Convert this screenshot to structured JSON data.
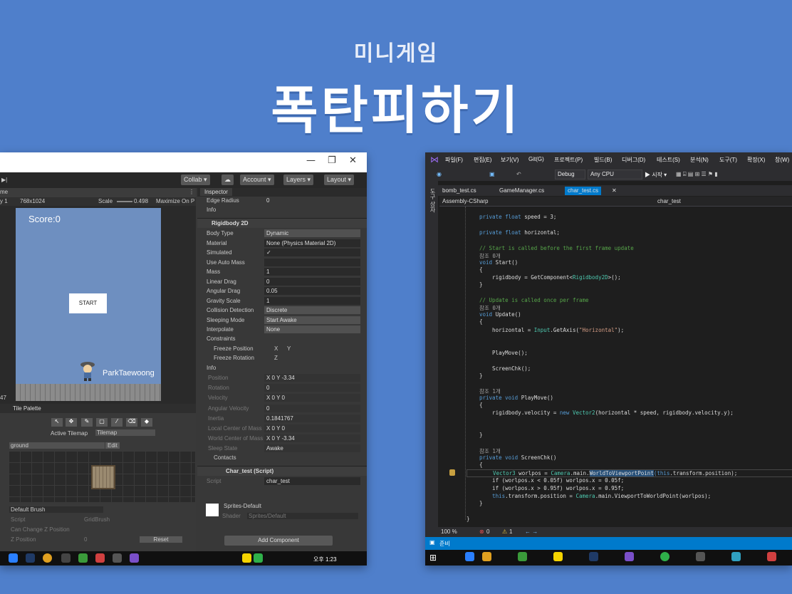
{
  "header": {
    "subtitle": "미니게임",
    "title": "폭탄피하기"
  },
  "unity": {
    "toolbar": {
      "collab": "Collab ▾",
      "account": "Account ▾",
      "layers": "Layers ▾",
      "layout": "Layout ▾"
    },
    "game": {
      "tab": "me",
      "display": "y 1",
      "resolution": "768x1024",
      "scale_label": "Scale",
      "scale_value": "0.498",
      "maximize": "Maximize On P",
      "score": "Score:0",
      "start": "START",
      "player_name": "ParkTaewoong"
    },
    "tile_palette": {
      "tab": "Tile Palette",
      "active_tilemap_label": "Active Tilemap",
      "active_tilemap": "Tilemap",
      "palette": "ground",
      "edit": "Edit",
      "brush": "Default Brush",
      "script_label": "Script",
      "script_value": "GridBrush",
      "can_change_z": "Can Change Z Position",
      "z_position": "Z Position",
      "z_value": "0",
      "reset": "Reset",
      "side_number": "47"
    },
    "inspector": {
      "tab": "Inspector",
      "edge_radius_label": "Edge Radius",
      "edge_radius": "0",
      "info1": "Info",
      "rb_title": "Rigidbody 2D",
      "fields": [
        {
          "label": "Body Type",
          "value": "Dynamic"
        },
        {
          "label": "Material",
          "value": "None (Physics Material 2D)"
        },
        {
          "label": "Simulated",
          "value": "✓"
        },
        {
          "label": "Use Auto Mass",
          "value": ""
        },
        {
          "label": "Mass",
          "value": "1"
        },
        {
          "label": "Linear Drag",
          "value": "0"
        },
        {
          "label": "Angular Drag",
          "value": "0.05"
        },
        {
          "label": "Gravity Scale",
          "value": "1"
        },
        {
          "label": "Collision Detection",
          "value": "Discrete"
        },
        {
          "label": "Sleeping Mode",
          "value": "Start Awake"
        },
        {
          "label": "Interpolate",
          "value": "None"
        }
      ],
      "constraints": "Constraints",
      "freeze_pos": "Freeze Position",
      "freeze_rot": "Freeze Rotation",
      "x": "X",
      "y": "Y",
      "z": "Z",
      "info2": "Info",
      "info_fields": [
        {
          "label": "Position",
          "value": "X 0      Y -3.34"
        },
        {
          "label": "Rotation",
          "value": "0"
        },
        {
          "label": "Velocity",
          "value": "X 0      Y 0"
        },
        {
          "label": "Angular Velocity",
          "value": "0"
        },
        {
          "label": "Inertia",
          "value": "0.1841767"
        },
        {
          "label": "Local Center of Mass",
          "value": "X 0      Y 0"
        },
        {
          "label": "World Center of Mass",
          "value": "X 0      Y -3.34"
        },
        {
          "label": "Sleep State",
          "value": "Awake"
        }
      ],
      "contacts": "Contacts",
      "script_comp": "Char_test (Script)",
      "script_label": "Script",
      "script_value": "char_test",
      "material_name": "Sprites-Default",
      "shader_label": "Shader",
      "shader_value": "Sprites/Default",
      "add_component": "Add Component"
    },
    "taskbar": {
      "time": "오후 1:23"
    }
  },
  "vs": {
    "menu": [
      "파일(F)",
      "편집(E)",
      "보기(V)",
      "Git(G)",
      "프로젝트(P)",
      "빌드(B)",
      "디버그(D)",
      "테스트(S)",
      "분석(N)",
      "도구(T)",
      "확장(X)",
      "창(W)"
    ],
    "config": "Debug",
    "platform": "Any CPU",
    "run": "▶ 시작 ▾",
    "side_label": "도구 상자",
    "tabs": [
      "bomb_test.cs",
      "GameManager.cs",
      "char_test.cs"
    ],
    "nav_left": "Assembly-CSharp",
    "nav_right": "char_test",
    "code": {
      "l1a": "private float",
      "l1b": " speed = 3;",
      "l2a": "private float",
      "l2b": " horizontal;",
      "c1": "// Start is called before the first frame update",
      "r1": "참조 0개",
      "s1": "void",
      "s1b": " Start()",
      "b1": "{",
      "s2": "    rigidbody = GetComponent<",
      "s2t": "Rigidbody2D",
      "s2e": ">();",
      "b2": "}",
      "c2": "// Update is called once per frame",
      "r2": "참조 0개",
      "u1": "void",
      "u1b": " Update()",
      "b3": "{",
      "u2": "    horizontal = ",
      "u2t": "Input",
      "u2m": ".GetAxis(",
      "u2s": "\"Horizontal\"",
      "u2e": ");",
      "u3": "    PlayMove();",
      "u4": "    ScreenChk();",
      "b4": "}",
      "r3": "참조 1개",
      "p1": "private void",
      "p1b": " PlayMove()",
      "b5": "{",
      "p2": "    rigidbody.velocity = ",
      "p2k": "new",
      "p2t": " Vector2",
      "p2e": "(horizontal * speed, rigidbody.velocity.y);",
      "b6": "}",
      "r4": "참조 1개",
      "q1": "private void",
      "q1b": " ScreenChk()",
      "b7": "{",
      "q2t": "    Vector3",
      "q2a": " worlpos = ",
      "q2c": "Camera",
      "q2m": ".main.",
      "q2h": "WorldToViewportPoint",
      "q2k": "(this",
      "q2e": ".transform.position);",
      "q3": "    if (worlpos.x < 0.05f) worlpos.x = 0.05f;",
      "q4": "    if (worlpos.x > 0.95f) worlpos.x = 0.95f;",
      "q5k": "    this",
      "q5a": ".transform.position = ",
      "q5c": "Camera",
      "q5e": ".main.ViewportToWorldPoint(worlpos);",
      "b8": "}",
      "b9": "}"
    },
    "zoom": "100 %",
    "errors": "0",
    "warnings": "1",
    "status": "준비"
  }
}
